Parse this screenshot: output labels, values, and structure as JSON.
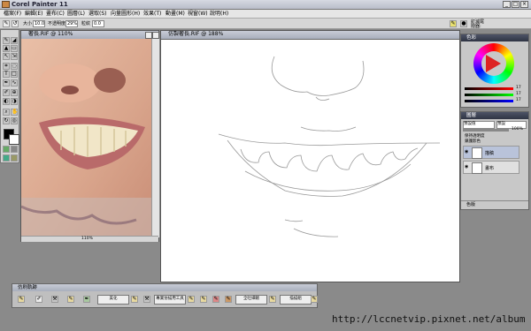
{
  "app": {
    "title": "Corel Painter 11"
  },
  "menu": [
    "檔案(F)",
    "編輯(E)",
    "畫布(C)",
    "圖層(L)",
    "選取(S)",
    "向量圖形(H)",
    "效果(T)",
    "動畫(M)",
    "視窗(W)",
    "說明(H)"
  ],
  "propbar": {
    "size_label": "大小",
    "size_value": "10.0",
    "opacity_label": "不透明度",
    "opacity_value": "29%",
    "grain_label": "粒紋",
    "grain_value": "0.0",
    "right_labels": [
      "釘滅尾",
      "撥器:"
    ]
  },
  "reference_window": {
    "title": "奢長.RIF @ 110%",
    "zoom": "110%"
  },
  "main_window": {
    "title": "仿製奢長.RIF @ 188%"
  },
  "color_panel": {
    "title": "色彩",
    "values": [
      "17",
      "17",
      "17"
    ]
  },
  "layers_panel": {
    "title": "圖層",
    "blend_mode": "預設值",
    "composite": "預設",
    "opacity": "100%",
    "options": [
      "保持透明度",
      "鎖護影色"
    ],
    "layers": [
      {
        "name": "描稿"
      },
      {
        "name": "畫布"
      }
    ],
    "footer": "色版"
  },
  "brush_tracker": {
    "title": "仿刷軌跡",
    "buttons": [
      "美化",
      "專業仿描用工具",
      "全吐細韌",
      "描描組"
    ]
  },
  "watermark": "http://lccnetvip.pixnet.net/album"
}
